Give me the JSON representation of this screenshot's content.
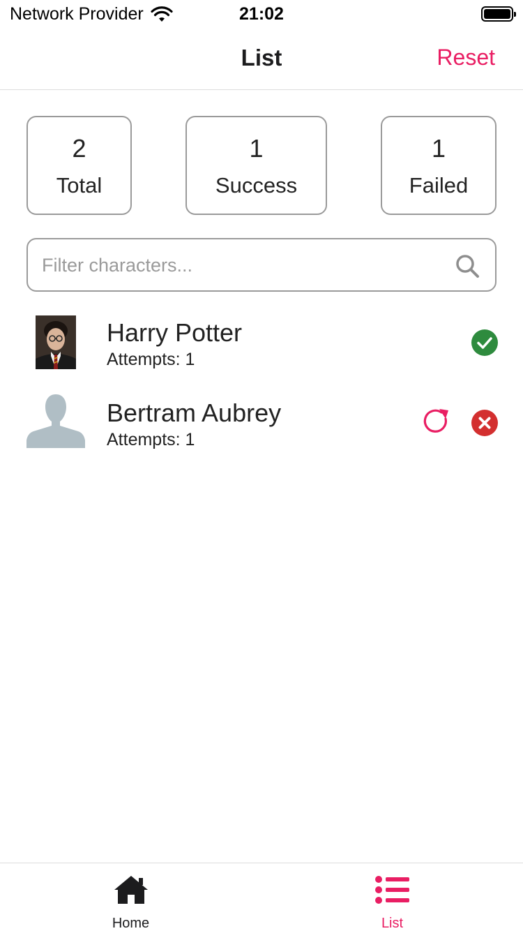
{
  "status_bar": {
    "carrier": "Network Provider",
    "time": "21:02"
  },
  "nav": {
    "title": "List",
    "reset_label": "Reset"
  },
  "stats": {
    "total": {
      "value": "2",
      "label": "Total"
    },
    "success": {
      "value": "1",
      "label": "Success"
    },
    "failed": {
      "value": "1",
      "label": "Failed"
    }
  },
  "search": {
    "placeholder": "Filter characters...",
    "value": ""
  },
  "characters": [
    {
      "name": "Harry Potter",
      "attempts": "Attempts: 1",
      "status": "success",
      "avatar": "photo"
    },
    {
      "name": "Bertram Aubrey",
      "attempts": "Attempts: 1",
      "status": "failed",
      "avatar": "placeholder-silhouette"
    }
  ],
  "tabs": [
    {
      "label": "Home",
      "icon": "home-icon",
      "active": false
    },
    {
      "label": "List",
      "icon": "list-icon",
      "active": true
    }
  ],
  "colors": {
    "accent": "#e91e63",
    "success": "#2e8b3e",
    "failed": "#d32f2f",
    "silhouette": "#b0bec5"
  }
}
